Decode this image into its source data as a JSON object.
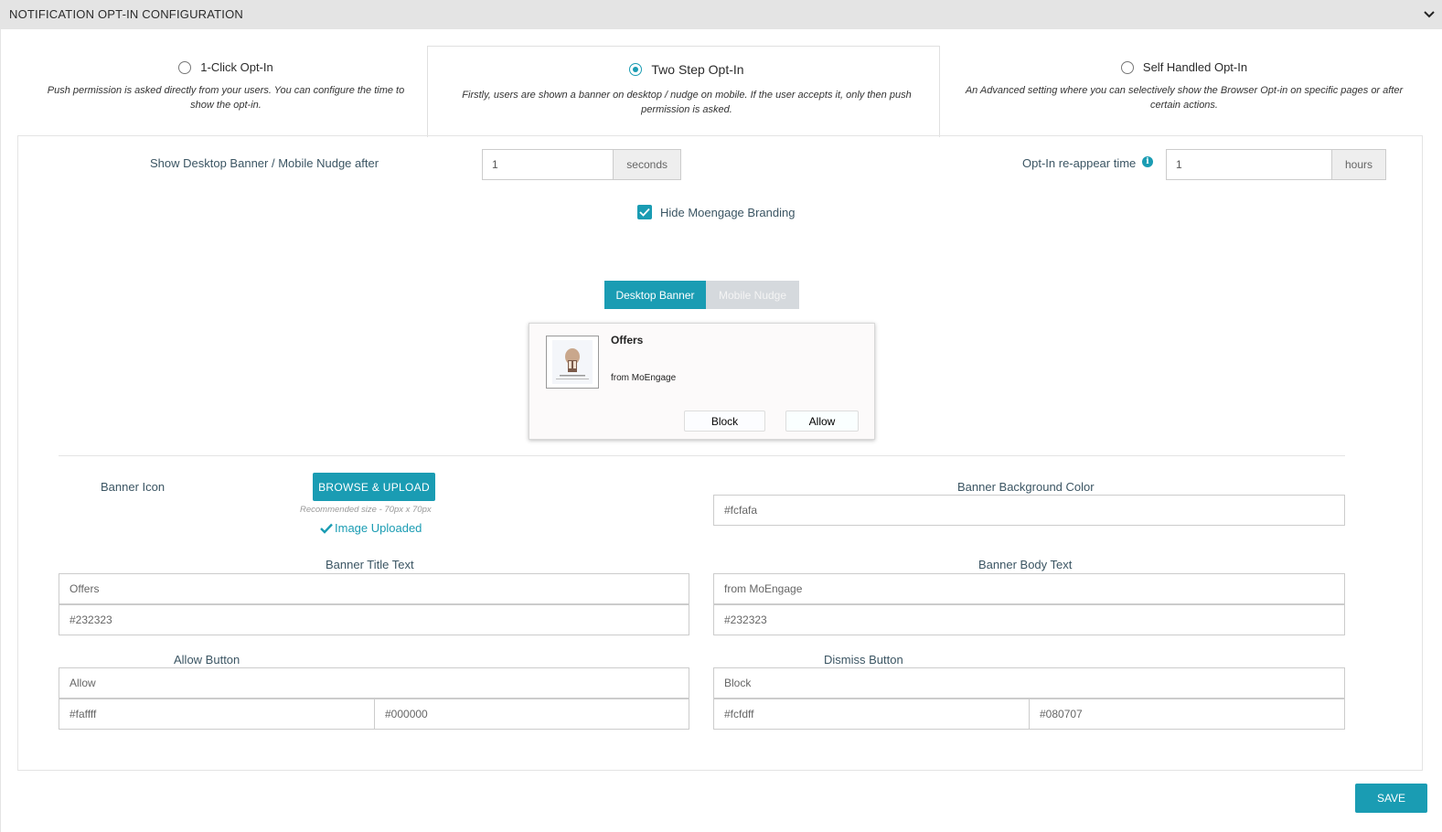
{
  "header": {
    "title": "NOTIFICATION OPT-IN CONFIGURATION"
  },
  "opt_in": {
    "options": [
      {
        "label": "1-Click Opt-In",
        "description": "Push permission is asked directly from your users. You can configure the time to show the opt-in.",
        "selected": false
      },
      {
        "label": "Two Step Opt-In",
        "description": "Firstly, users are shown a banner on desktop / nudge on mobile. If the user accepts it, only then push permission is asked.",
        "selected": true
      },
      {
        "label": "Self Handled Opt-In",
        "description": "An Advanced setting where you can selectively show the Browser Opt-in on specific pages or after certain actions.",
        "selected": false
      }
    ]
  },
  "settings": {
    "show_after_label": "Show Desktop Banner / Mobile Nudge after",
    "show_after_value": "1",
    "show_after_unit": "seconds",
    "reappear_label": "Opt-In re-appear time",
    "reappear_value": "1",
    "reappear_unit": "hours",
    "hide_branding_label": "Hide Moengage Branding",
    "hide_branding_checked": true
  },
  "tabs": {
    "desktop": "Desktop Banner",
    "mobile": "Mobile Nudge"
  },
  "preview": {
    "title": "Offers",
    "body": "from MoEngage",
    "block_label": "Block",
    "allow_label": "Allow"
  },
  "form": {
    "banner_icon_label": "Banner Icon",
    "upload_label": "BROWSE & UPLOAD",
    "recommended_size": "Recommended size - 70px x 70px",
    "uploaded_label": "Image Uploaded",
    "bg_color_label": "Banner Background Color",
    "bg_color_value": "#fcfafa",
    "title_text_label": "Banner Title Text",
    "title_text_value": "Offers",
    "title_color_value": "#232323",
    "body_text_label": "Banner Body Text",
    "body_text_value": "from MoEngage",
    "body_color_value": "#232323",
    "allow_button_label": "Allow Button",
    "allow_text_value": "Allow",
    "allow_bg_value": "#faffff",
    "allow_fg_value": "#000000",
    "dismiss_button_label": "Dismiss Button",
    "dismiss_text_value": "Block",
    "dismiss_bg_value": "#fcfdff",
    "dismiss_fg_value": "#080707"
  },
  "footer": {
    "save_label": "SAVE"
  },
  "colors": {
    "accent": "#1a9cb3",
    "header_bg": "#e4e4e4",
    "tab_inactive": "#d5d9dd"
  },
  "icons": {
    "chevron": "chevron-down-icon",
    "info": "info-icon",
    "check": "checkmark-icon"
  }
}
